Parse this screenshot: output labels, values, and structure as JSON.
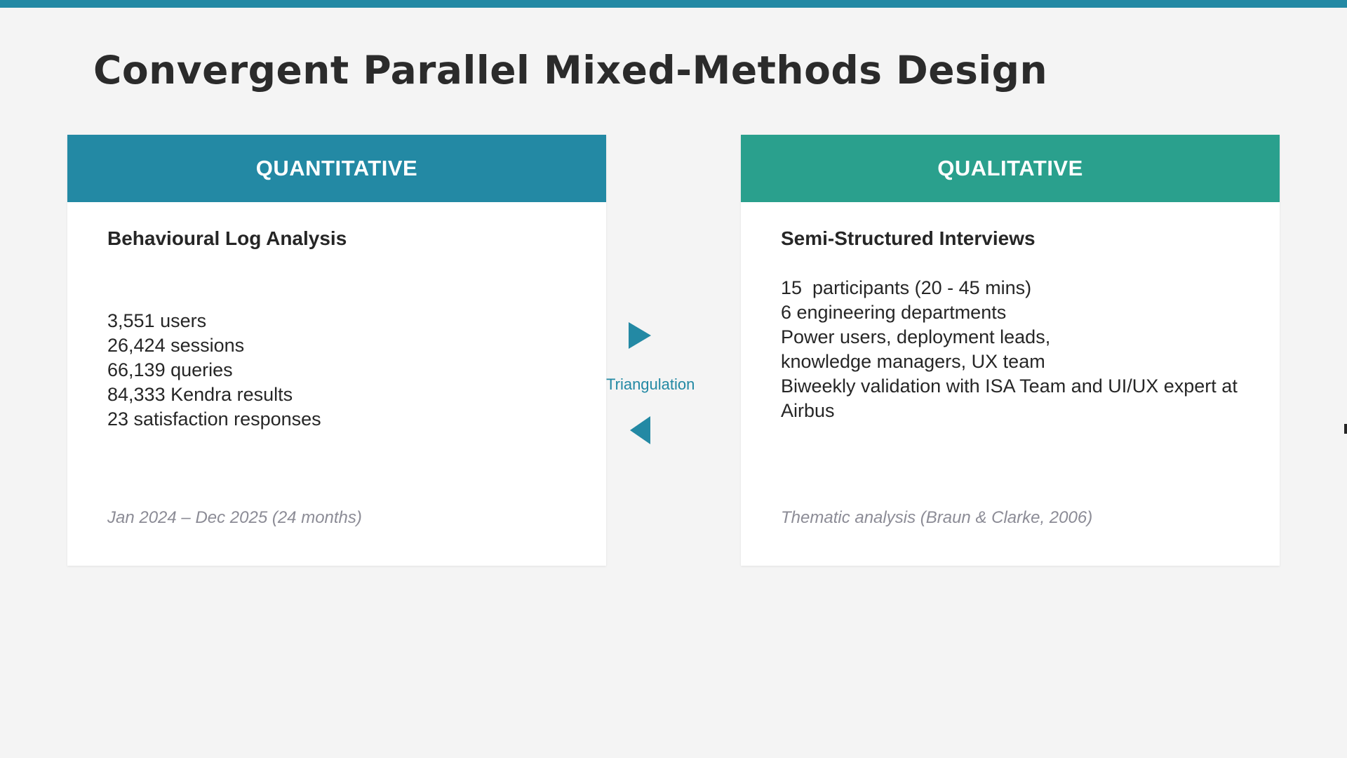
{
  "slide": {
    "title": "Convergent Parallel Mixed-Methods Design"
  },
  "colors": {
    "accent": "#2389a4",
    "qualitative": "#2aa08d",
    "background": "#f4f4f4",
    "footer_text": "#8c8c96"
  },
  "quantitative": {
    "header": "QUANTITATIVE",
    "subtitle": "Behavioural Log Analysis",
    "items": [
      "3,551 users",
      "26,424 sessions",
      "66,139 queries",
      "84,333 Kendra results",
      "23 satisfaction responses"
    ],
    "footer": "Jan 2024 – Dec 2025 (24 months)"
  },
  "qualitative": {
    "header": "QUALITATIVE",
    "subtitle": "Semi-Structured Interviews",
    "items": [
      "15  participants (20 - 45 mins)",
      "6 engineering departments",
      "Power users, deployment leads,",
      "knowledge managers, UX team",
      "Biweekly validation with ISA Team and UI/UX expert at Airbus"
    ],
    "footer": "Thematic analysis (Braun & Clarke, 2006)"
  },
  "connector": {
    "label": "Triangulation",
    "icons": [
      "arrow-right-icon",
      "arrow-left-icon"
    ]
  }
}
